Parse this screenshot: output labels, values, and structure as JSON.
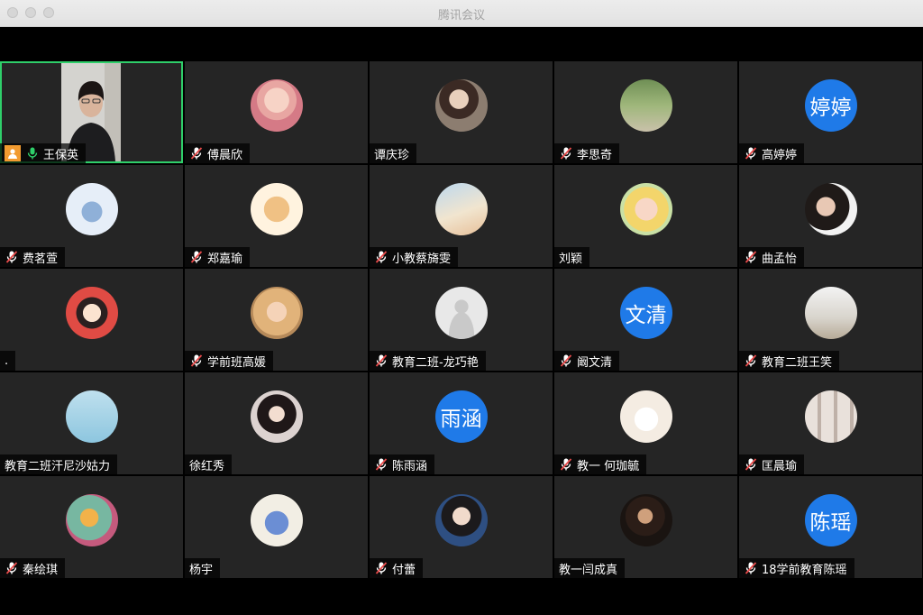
{
  "window": {
    "title": "腾讯会议"
  },
  "colors": {
    "accent_blue": "#1f7ae8",
    "active_border": "#2fcf6a",
    "tile_bg": "#252525",
    "host_badge": "#f29b30"
  },
  "participants": [
    {
      "name": "王保英",
      "muted": false,
      "video": true,
      "active": true,
      "host": true
    },
    {
      "name": "傅晨欣",
      "muted": true,
      "avatar": "photo-girl-pink"
    },
    {
      "name": "谭庆珍",
      "muted": false,
      "avatar": "photo-girl-study"
    },
    {
      "name": "李思奇",
      "muted": true,
      "avatar": "photo-cat-outdoor"
    },
    {
      "name": "高婷婷",
      "muted": true,
      "avatar_text": "婷婷"
    },
    {
      "name": "费茗萱",
      "muted": true,
      "avatar": "drawing-girl-sitting"
    },
    {
      "name": "郑嘉瑜",
      "muted": true,
      "avatar": "drawing-shiba-dog"
    },
    {
      "name": "小教蔡旖雯",
      "muted": true,
      "avatar": "photo-sky-clouds"
    },
    {
      "name": "刘颖",
      "muted": false,
      "avatar": "cartoon-sailor-moon"
    },
    {
      "name": "曲孟怡",
      "muted": true,
      "avatar": "photo-girl-portrait"
    },
    {
      "name": ".",
      "muted": false,
      "avatar": "cartoon-girl-red"
    },
    {
      "name": "学前班高媛",
      "muted": true,
      "avatar": "photo-girl-blonde"
    },
    {
      "name": "教育二班-龙巧艳",
      "muted": true,
      "avatar": "default-person"
    },
    {
      "name": "阚文清",
      "muted": true,
      "avatar_text": "文清"
    },
    {
      "name": "教育二班王笑",
      "muted": true,
      "avatar": "photo-girl-number-6"
    },
    {
      "name": "教育二班汗尼沙姑力",
      "muted": false,
      "avatar": "drawing-girl-lying"
    },
    {
      "name": "徐红秀",
      "muted": false,
      "avatar": "drawing-girl-dark"
    },
    {
      "name": "陈雨涵",
      "muted": true,
      "avatar_text": "雨涵"
    },
    {
      "name": "教一 何珈毓",
      "muted": true,
      "avatar": "drawing-rabbit"
    },
    {
      "name": "匡晨瑜",
      "muted": true,
      "avatar": "photo-collage-boys"
    },
    {
      "name": "秦绘琪",
      "muted": true,
      "avatar": "drawing-bird-flowers"
    },
    {
      "name": "杨宇",
      "muted": false,
      "avatar": "cartoon-tom-cat"
    },
    {
      "name": "付蕾",
      "muted": true,
      "avatar": "photo-girl-hoodie"
    },
    {
      "name": "教一闫成真",
      "muted": false,
      "avatar": "photo-girl-dark-bg"
    },
    {
      "name": "18学前教育陈瑶",
      "muted": true,
      "avatar_text": "陈瑶"
    }
  ]
}
